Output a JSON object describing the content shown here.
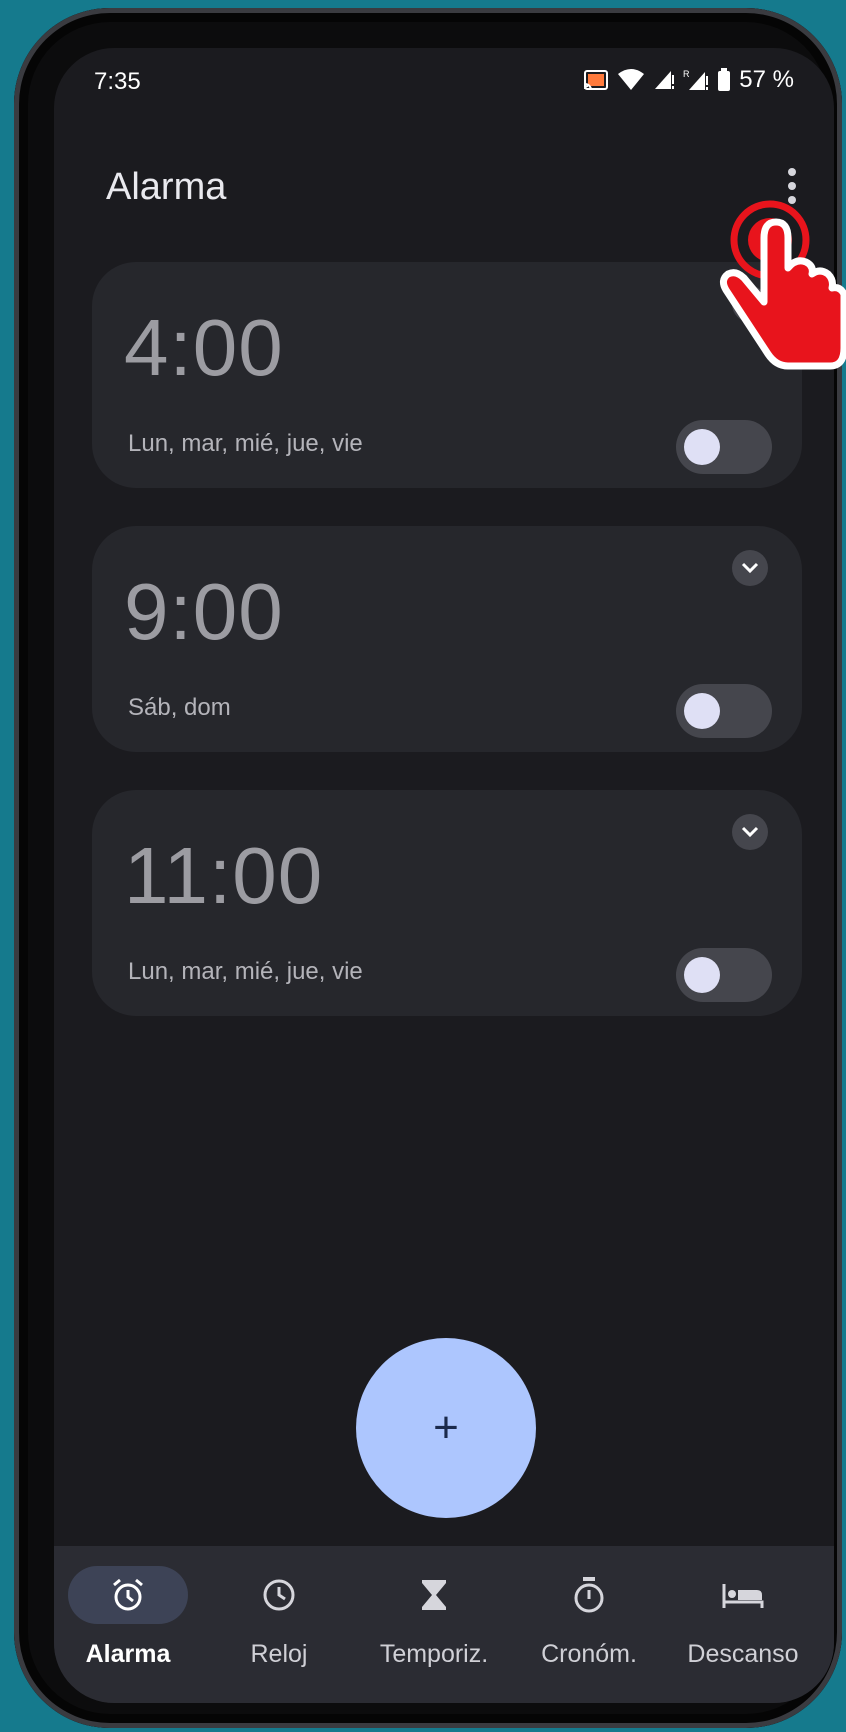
{
  "status_bar": {
    "time": "7:35",
    "battery": "57 %"
  },
  "header": {
    "title": "Alarma"
  },
  "alarms": [
    {
      "time": "4:00",
      "days": "Lun, mar, mié, jue, vie",
      "enabled": false
    },
    {
      "time": "9:00",
      "days": "Sáb, dom",
      "enabled": false
    },
    {
      "time": "11:00",
      "days": "Lun, mar, mié, jue, vie",
      "enabled": false
    }
  ],
  "fab": {
    "label": "+"
  },
  "nav": [
    {
      "label": "Alarma",
      "icon": "alarm-icon",
      "active": true
    },
    {
      "label": "Reloj",
      "icon": "clock-icon",
      "active": false
    },
    {
      "label": "Temporiz.",
      "icon": "hourglass-icon",
      "active": false
    },
    {
      "label": "Cronóm.",
      "icon": "stopwatch-icon",
      "active": false
    },
    {
      "label": "Descanso",
      "icon": "bed-icon",
      "active": false
    }
  ],
  "colors": {
    "accent": "#adc6fe",
    "background": "#1b1b1f",
    "card": "#26272c",
    "tap_indicator": "#e8141c"
  }
}
